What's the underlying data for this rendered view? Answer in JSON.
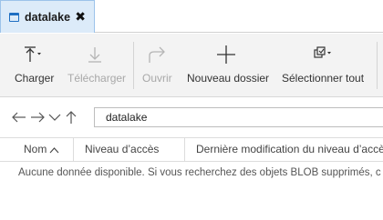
{
  "tabs": [
    {
      "label": "datalake",
      "active": true,
      "close_glyph": "✖"
    }
  ],
  "toolbar": {
    "items": [
      {
        "name": "upload",
        "label": "Charger",
        "icon": "upload-icon",
        "enabled": true
      },
      {
        "name": "download",
        "label": "Télécharger",
        "icon": "download-icon",
        "enabled": false
      },
      {
        "name": "open",
        "label": "Ouvrir",
        "icon": "open-arrow-icon",
        "enabled": false
      },
      {
        "name": "new-folder",
        "label": "Nouveau dossier",
        "icon": "plus-icon",
        "enabled": true
      },
      {
        "name": "select-all",
        "label": "Sélectionner tout",
        "icon": "select-all-icon",
        "enabled": true
      }
    ]
  },
  "navigation": {
    "address": "datalake",
    "buttons": [
      "back-arrow-icon",
      "forward-arrow-icon",
      "chevron-down-icon",
      "up-arrow-icon"
    ]
  },
  "table": {
    "columns": [
      "Nom",
      "Niveau d’accès",
      "Dernière modification du niveau d’accès"
    ],
    "sort_column": "Nom",
    "empty_message": "Aucune donnée disponible. Si vous recherchez des objets BLOB supprimés, c"
  },
  "colors": {
    "accent": "#1f6fc2",
    "tab_active_bg": "#dcebf9",
    "toolbar_bg": "#f3f3f3",
    "disabled_text": "#a8a8a8"
  }
}
